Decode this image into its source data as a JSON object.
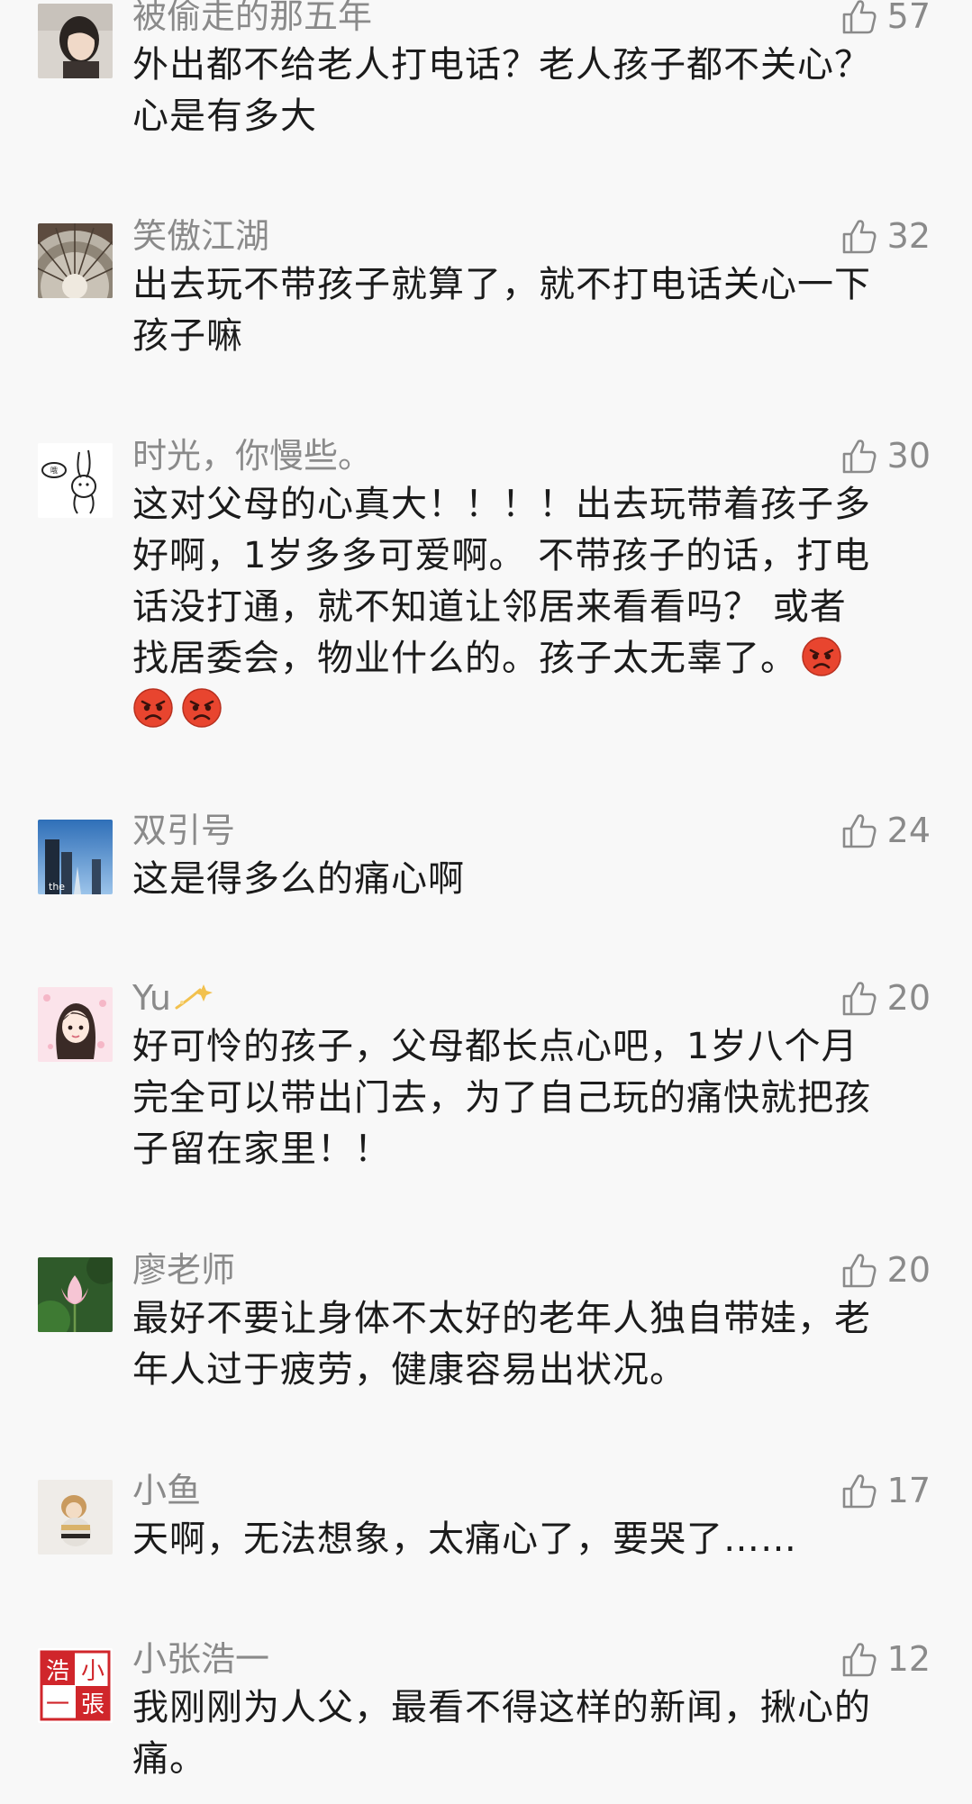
{
  "comments": [
    {
      "author": "被偷走的那五年",
      "likes": "57",
      "lines": [
        "外出都不给老人打电话？老人孩子都不关心？",
        "心是有多大"
      ],
      "avatar": "woman-photo-avatar"
    },
    {
      "author": "笑傲江湖",
      "likes": "32",
      "lines": [
        "出去玩不带孩子就算了，就不打电话关心一下",
        "孩子嘛"
      ],
      "avatar": "glass-dome-avatar"
    },
    {
      "author": "时光，你慢些。",
      "likes": "30",
      "lines": [
        "这对父母的心真大！！！！出去玩带着孩子多",
        "好啊，1岁多多可爱啊。 不带孩子的话，打电",
        "话没打通，就不知道让邻居来看看吗？ 或者",
        "找居委会，物业什么的。孩子太无辜了。"
      ],
      "emoji_line": "",
      "avatar": "rabbit-sketch-avatar"
    },
    {
      "author": "双引号",
      "likes": "24",
      "lines": [
        "这是得多么的痛心啊"
      ],
      "avatar": "city-building-avatar"
    },
    {
      "author": "Yu",
      "likes": "20",
      "lines": [
        "好可怜的孩子，父母都长点心吧，1岁八个月",
        "完全可以带出门去，为了自己玩的痛快就把孩",
        "子留在家里！！"
      ],
      "avatar": "cartoon-girl-avatar"
    },
    {
      "author": "廖老师",
      "likes": "20",
      "lines": [
        "最好不要让身体不太好的老年人独自带娃，老",
        "年人过于疲劳，健康容易出状况。"
      ],
      "avatar": "lotus-flower-avatar"
    },
    {
      "author": "小鱼",
      "likes": "17",
      "lines": [
        "天啊，无法想象，太痛心了，要哭了……"
      ],
      "avatar": "toy-figure-avatar"
    },
    {
      "author": "小张浩一",
      "likes": "12",
      "lines": [
        "我刚刚为人父，最看不得这样的新闻，揪心的",
        "痛。"
      ],
      "avatar": "red-seal-avatar",
      "seal_chars": [
        "浩",
        "小",
        "一",
        "張"
      ]
    }
  ],
  "colors": {
    "background": "#f8f8f8",
    "meta_text": "#8a8a8a",
    "body_text": "#1b1b1b",
    "seal_red": "#d0262b",
    "angry_face": "#e8452f"
  }
}
